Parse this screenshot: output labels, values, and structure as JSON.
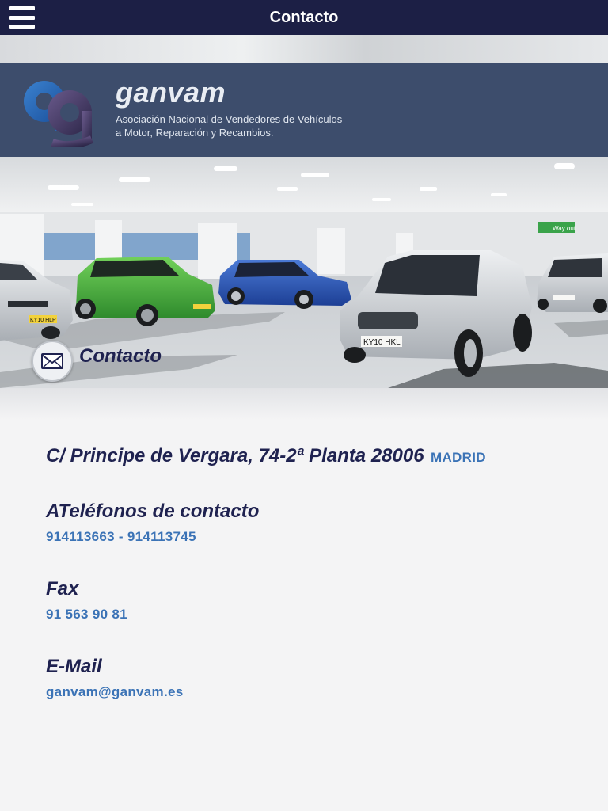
{
  "header": {
    "title": "Contacto",
    "menu_icon": "hamburger-menu-icon"
  },
  "hero": {
    "brand": "ganvam",
    "brand_line1": "Asociación Nacional de Vendedores de Vehículos",
    "brand_line2": "a Motor, Reparación y Recambios.",
    "title": "Contacto",
    "badge_icon": "envelope-icon",
    "plates": [
      "KY10 HLP",
      "KY10 HKL"
    ],
    "sign_text": "Way out"
  },
  "address": {
    "street": "C/ Principe de Vergara, 74-2ª Planta 28006",
    "city": "MADRID"
  },
  "phones": {
    "label": "ATeléfonos de contacto",
    "value": "914113663 - 914113745"
  },
  "fax": {
    "label": "Fax",
    "value": "91 563 90 81"
  },
  "email": {
    "label": "E-Mail",
    "value": "ganvam@ganvam.es"
  },
  "colors": {
    "header_bg": "#1c1f45",
    "heading": "#1f2250",
    "link": "#3b73b6",
    "logo_band": "#3d4d6c"
  }
}
